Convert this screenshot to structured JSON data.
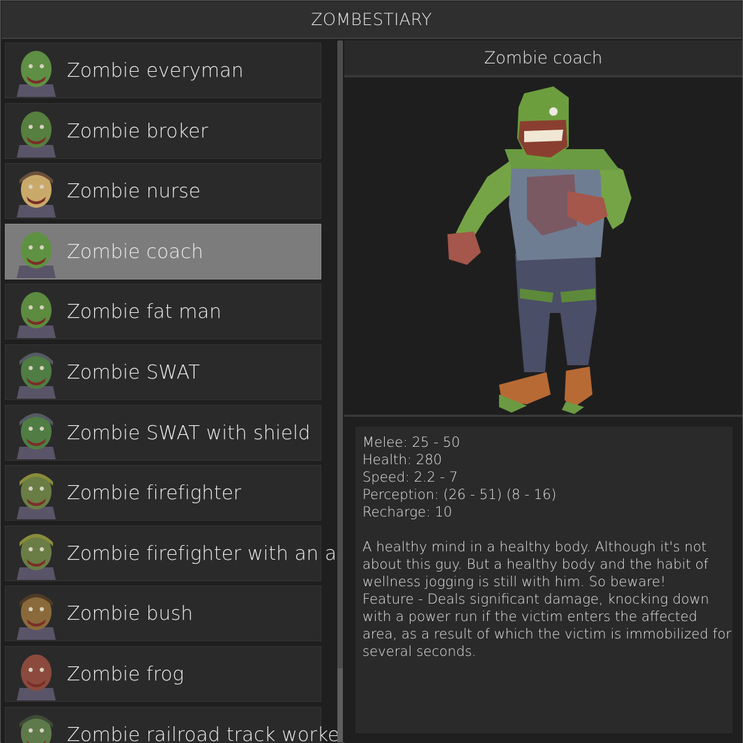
{
  "app": {
    "title": "ZOMBESTIARY"
  },
  "colors": {
    "background": "#1d1d1d",
    "panel": "#2a2a2a",
    "selected": "#7c7c7c",
    "text": "#ededed"
  },
  "list": {
    "items": [
      {
        "label": "Zombie everyman",
        "icon": "zombie-everyman-portrait"
      },
      {
        "label": "Zombie broker",
        "icon": "zombie-broker-portrait"
      },
      {
        "label": "Zombie nurse",
        "icon": "zombie-nurse-portrait"
      },
      {
        "label": "Zombie coach",
        "icon": "zombie-coach-portrait",
        "selected": true
      },
      {
        "label": "Zombie fat man",
        "icon": "zombie-fat-man-portrait"
      },
      {
        "label": "Zombie SWAT",
        "icon": "zombie-swat-portrait"
      },
      {
        "label": "Zombie SWAT with shield",
        "icon": "zombie-swat-shield-portrait"
      },
      {
        "label": "Zombie firefighter",
        "icon": "zombie-firefighter-portrait"
      },
      {
        "label": "Zombie firefighter with an ax",
        "icon": "zombie-firefighter-ax-portrait"
      },
      {
        "label": "Zombie bush",
        "icon": "zombie-bush-portrait"
      },
      {
        "label": "Zombie frog",
        "icon": "zombie-frog-portrait"
      },
      {
        "label": "Zombie railroad track worker",
        "icon": "zombie-railroad-worker-portrait"
      }
    ]
  },
  "detail": {
    "title": "Zombie coach",
    "preview_icon": "zombie-coach-model",
    "stats": {
      "melee": "Melee: 25 - 50",
      "health": "Health: 280",
      "speed": "Speed: 2.2 - 7",
      "perception": "Perception: (26 - 51) (8 - 16)",
      "recharge": "Recharge: 10"
    },
    "description_lines": [
      "A healthy mind in a healthy body. Although it's not",
      "about this guy. But a healthy body and the habit of",
      "wellness jogging is still with him. So beware!",
      "Feature - Deals significant damage, knocking down",
      "with a power run if the victim enters the affected",
      "area, as a result of which the victim is immobilized for",
      "several seconds."
    ]
  }
}
